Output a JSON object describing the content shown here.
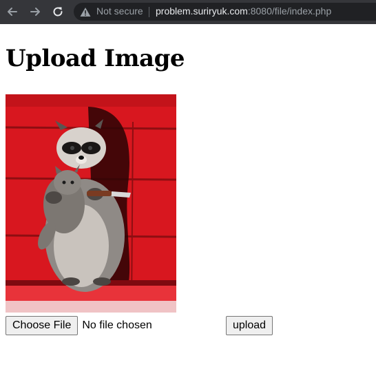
{
  "browser": {
    "back_icon": "arrow-left-icon",
    "forward_icon": "arrow-right-icon",
    "reload_icon": "reload-icon",
    "security_icon": "warning-triangle-icon",
    "security_label": "Not secure",
    "url_host": "problem.suriryuk.com",
    "url_rest": ":8080/file/index.php",
    "toolbar_color": "#35363a",
    "omnibox_color": "#202124"
  },
  "page": {
    "title": "Upload Image",
    "image_subject": "raccoon holding a kitten and a knife on red background",
    "file_input": {
      "button_label": "Choose File",
      "status": "No file chosen"
    },
    "upload_label": "upload"
  }
}
